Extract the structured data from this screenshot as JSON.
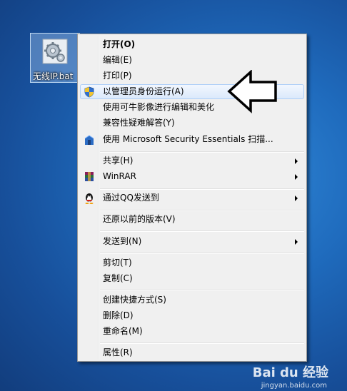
{
  "desktop": {
    "icon_label": "无线IP.bat"
  },
  "menu": {
    "items": [
      {
        "label": "打开(O)",
        "icon": "none"
      },
      {
        "label": "编辑(E)",
        "icon": "none"
      },
      {
        "label": "打印(P)",
        "icon": "none"
      },
      {
        "label": "以管理员身份运行(A)",
        "icon": "uac-shield-icon"
      },
      {
        "label": "使用可牛影像进行编辑和美化",
        "icon": "none"
      },
      {
        "label": "兼容性疑难解答(Y)",
        "icon": "none"
      },
      {
        "label": "使用 Microsoft Security Essentials 扫描...",
        "icon": "mse-icon"
      },
      {
        "label": "共享(H)",
        "icon": "none"
      },
      {
        "label": "WinRAR",
        "icon": "winrar-icon"
      },
      {
        "label": "通过QQ发送到",
        "icon": "qq-penguin-icon"
      },
      {
        "label": "还原以前的版本(V)",
        "icon": "none"
      },
      {
        "label": "发送到(N)",
        "icon": "none"
      },
      {
        "label": "剪切(T)",
        "icon": "none"
      },
      {
        "label": "复制(C)",
        "icon": "none"
      },
      {
        "label": "创建快捷方式(S)",
        "icon": "none"
      },
      {
        "label": "删除(D)",
        "icon": "none"
      },
      {
        "label": "重命名(M)",
        "icon": "none"
      },
      {
        "label": "属性(R)",
        "icon": "none"
      }
    ],
    "highlighted_item": "以管理员身份运行(A)"
  },
  "watermark": {
    "brand": "Bai du 经验",
    "url": "jingyan.baidu.com"
  },
  "colors": {
    "desktop_background": "#1f6bbd",
    "menu_background": "#f0f0f0",
    "hover_border": "#aecff7"
  }
}
